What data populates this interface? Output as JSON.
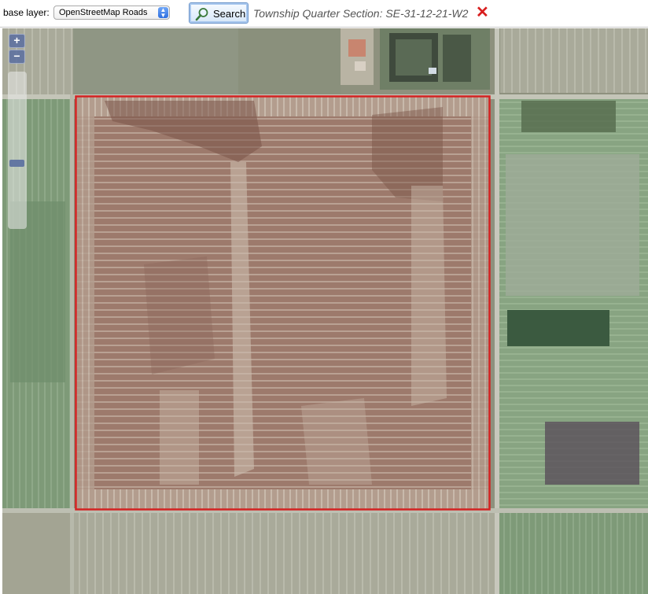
{
  "toolbar": {
    "base_layer_label": "base layer:",
    "base_layer_selected": "OpenStreetMap Roads",
    "search_label": "Search",
    "result_text": "Township Quarter Section: SE-31-12-21-W2"
  },
  "map": {
    "zoom_in_label": "+",
    "zoom_out_label": "−",
    "boundary_color": "#d42222"
  },
  "icons": {
    "search": "magnifier-icon",
    "clear": "close-x-icon",
    "select": "up-down-chevron-icon"
  }
}
